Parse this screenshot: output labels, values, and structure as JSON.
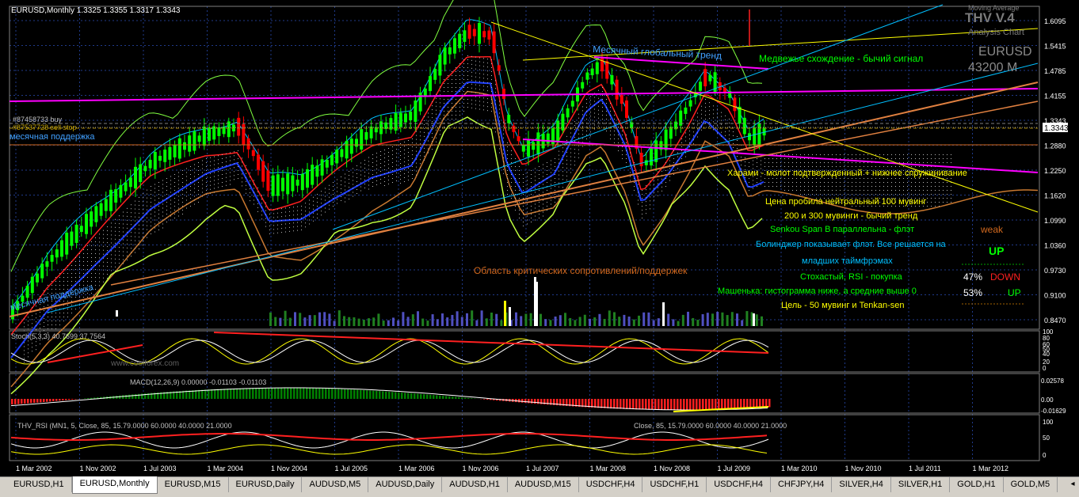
{
  "window": {
    "symbol_line": "EURUSD,Monthly  1.3325 1.3355 1.3317 1.3343",
    "brand_title": "THV V.4",
    "brand_sub": "Analysis Chart",
    "brand_top": "Moving Average",
    "symbol": "EURUSD",
    "timeframe": "43200 M",
    "watermark": "www.coolforex.com",
    "current_price": "1.3343"
  },
  "colors": {
    "up": "#00ff00",
    "down": "#ff0000",
    "grid": "#1f3a8a",
    "magenta": "#ff00ff",
    "orange": "#d2691e",
    "yellow": "#ffff00",
    "cyan": "#00bfff",
    "text_green": "#00ff00",
    "text_yellow": "#ffff00"
  },
  "price_axis": [
    "1.6095",
    "1.5415",
    "1.4785",
    "1.4155",
    "1.3343",
    "1.2880",
    "1.2250",
    "1.1620",
    "1.0990",
    "1.0360",
    "0.9730",
    "0.9100",
    "0.8470"
  ],
  "stoch_axis": [
    "100",
    "80",
    "60",
    "50",
    "40",
    "20",
    "0"
  ],
  "macd_axis": [
    "0.02578",
    "0.00",
    "-0.01629"
  ],
  "rsi_axis": [
    "100",
    "50",
    "0"
  ],
  "time_axis": [
    "1 Mar 2002",
    "1 Nov 2002",
    "1 Jul 2003",
    "1 Mar 2004",
    "1 Nov 2004",
    "1 Jul 2005",
    "1 Mar 2006",
    "1 Nov 2006",
    "1 Jul 2007",
    "1 Mar 2008",
    "1 Nov 2008",
    "1 Jul 2009",
    "1 Mar 2010",
    "1 Nov 2010",
    "1 Jul 2011",
    "1 Mar 2012"
  ],
  "labels": {
    "order_buy": "#87458733 buy",
    "order_sl": "#87537728 sell stop",
    "monthly_support": "месячная поддержка",
    "monthly_support2": "месячная поддержка",
    "monthly_global_trend": "Месячный глобальный тренд",
    "bearish_divergence": "Медвежье схождение - бычий сигнал",
    "harami": "Харами - молот подтвержденный + нижнее спружинивание",
    "critical_area": "Область критических сопротивлений/поддержек",
    "line1": "Цена пробила  нейтральный 100 мувинг",
    "line2": "200 и 300 мувинги - бычий тренд",
    "line3": "Senkou Span B параллельна - флэт",
    "line4": "Болинджер показывает флэт. Все решается на",
    "line5": "младших таймфрэмах",
    "line6": "Стохастый, RSI -  покупка",
    "line7": "Машенька: гистограмма ниже, а средние выше 0",
    "line8": "Цель - 50 мувинг и Tenkan-sen",
    "weak": "weak",
    "up_big": "UP",
    "pct_down": "47%",
    "down_label": "DOWN",
    "pct_up": "53%",
    "up_label": "UP"
  },
  "indicators": {
    "stoch": "Stoch(5,3,3) 40.7699 37.7564",
    "macd": "MACD(12,26,9) 0.00000 -0.01103 -0.01103",
    "rsi_left": "THV_RSI (MN1, 5, Close, 85, 15.79.0000 60.0000 40.0000 21.0000",
    "rsi_right": "Close, 85, 15.79.0000 60.0000 40.0000 21.0000"
  },
  "tabs": [
    {
      "label": "EURUSD,H1",
      "active": false
    },
    {
      "label": "EURUSD,Monthly",
      "active": true
    },
    {
      "label": "EURUSD,M15",
      "active": false
    },
    {
      "label": "EURUSD,Daily",
      "active": false
    },
    {
      "label": "AUDUSD,M5",
      "active": false
    },
    {
      "label": "AUDUSD,Daily",
      "active": false
    },
    {
      "label": "AUDUSD,H1",
      "active": false
    },
    {
      "label": "AUDUSD,M15",
      "active": false
    },
    {
      "label": "USDCHF,H4",
      "active": false
    },
    {
      "label": "USDCHF,H1",
      "active": false
    },
    {
      "label": "USDCHF,H4",
      "active": false
    },
    {
      "label": "CHFJPY,H4",
      "active": false
    },
    {
      "label": "SILVER,H4",
      "active": false
    },
    {
      "label": "SILVER,H1",
      "active": false
    },
    {
      "label": "GOLD,H1",
      "active": false
    },
    {
      "label": "GOLD,M5",
      "active": false
    }
  ],
  "tab_scroll": "◂"
}
